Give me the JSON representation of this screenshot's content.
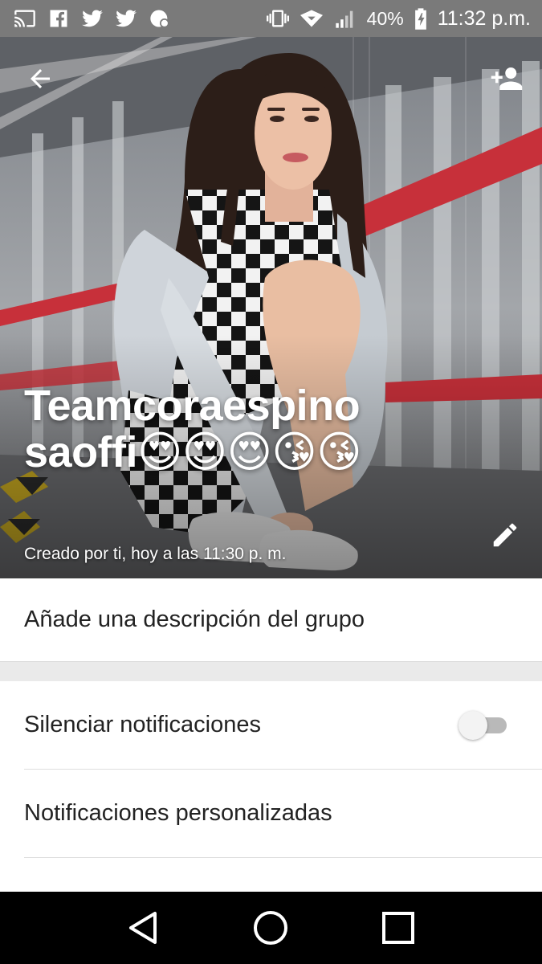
{
  "status_bar": {
    "battery": "40%",
    "time": "11:32 p.m.",
    "left_icons": [
      "cast-icon",
      "facebook-icon",
      "twitter-icon",
      "twitter-icon",
      "app-notification-icon"
    ],
    "right_icons": [
      "vibrate-icon",
      "wifi-icon",
      "signal-icon",
      "battery-charging-icon"
    ]
  },
  "header": {
    "title": "Teamcoraespinosaoffi😍😍😍😘😘",
    "subtitle": "Creado por ti, hoy a las 11:30 p. m.",
    "back_icon": "arrow-back-icon",
    "add_icon": "add-person-icon",
    "edit_icon": "pencil-icon"
  },
  "description": {
    "label": "Añade una descripción del grupo"
  },
  "settings": {
    "mute_label": "Silenciar notificaciones",
    "mute_on": false,
    "custom_label": "Notificaciones personalizadas"
  },
  "nav": {
    "icons": [
      "back-triangle-icon",
      "home-circle-icon",
      "recents-square-icon"
    ]
  }
}
